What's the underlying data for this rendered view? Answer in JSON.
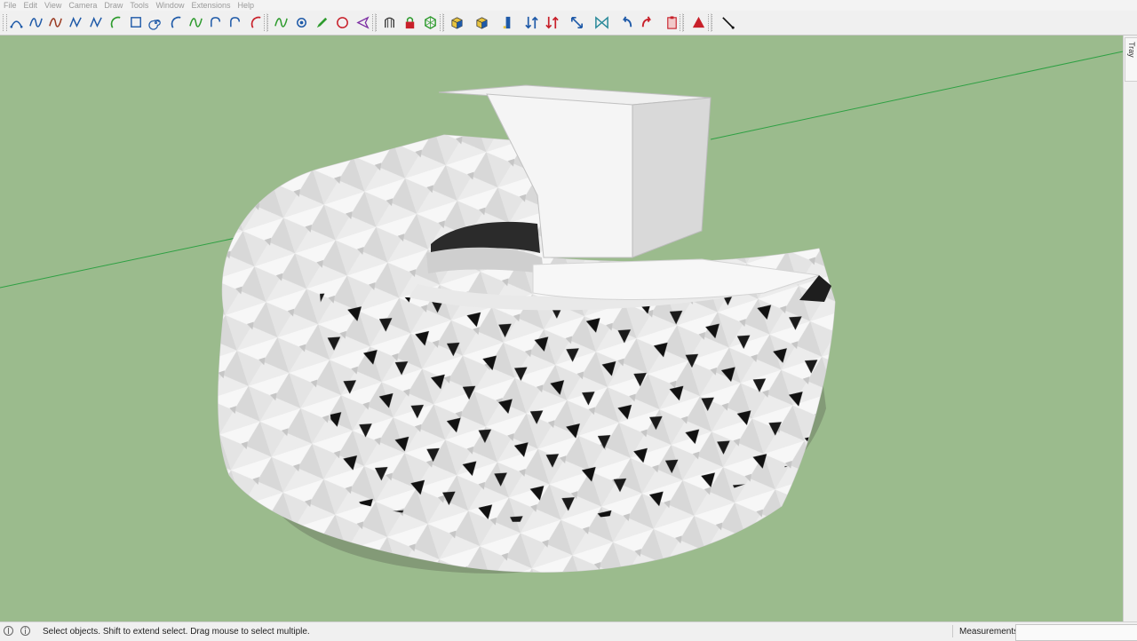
{
  "menu": [
    "File",
    "Edit",
    "View",
    "Camera",
    "Draw",
    "Tools",
    "Window",
    "Extensions",
    "Help"
  ],
  "toolbar": {
    "icons": [
      {
        "name": "bezier-curve-icon",
        "color": "#1f5aa8",
        "glyph": "arch"
      },
      {
        "name": "spline-tool-icon",
        "color": "#1f5aa8",
        "glyph": "wave"
      },
      {
        "name": "freehand-spline-icon",
        "color": "#9b3b22",
        "glyph": "wave"
      },
      {
        "name": "polyline-curve-icon",
        "color": "#1f5aa8",
        "glyph": "zigzag"
      },
      {
        "name": "curve-node-icon",
        "color": "#1f5aa8",
        "glyph": "zigzag"
      },
      {
        "name": "arc-green-icon",
        "color": "#2e9b2e",
        "glyph": "arc"
      },
      {
        "name": "rectangle-tool-icon",
        "color": "#1f5aa8",
        "glyph": "square"
      },
      {
        "name": "spiral-icon",
        "color": "#1f5aa8",
        "glyph": "spiral"
      },
      {
        "name": "arc-tool-icon",
        "color": "#1f5aa8",
        "glyph": "arc"
      },
      {
        "name": "sine-curve-icon",
        "color": "#2e9b2e",
        "glyph": "wave"
      },
      {
        "name": "catenary-curve-icon",
        "color": "#1f5aa8",
        "glyph": "hook"
      },
      {
        "name": "arch-curve-icon",
        "color": "#1f5aa8",
        "glyph": "hook"
      },
      {
        "name": "red-arc-icon",
        "color": "#c8202a",
        "glyph": "arc"
      },
      {
        "name": "line-weave-icon",
        "color": "#2e9b2e",
        "glyph": "wave"
      },
      {
        "name": "polygon-circle-icon",
        "color": "#1f5aa8",
        "glyph": "gear"
      },
      {
        "name": "pencil-tool-icon",
        "color": "#2e9b2e",
        "glyph": "pencil"
      },
      {
        "name": "circle-tool-icon",
        "color": "#c8202a",
        "glyph": "circle"
      },
      {
        "name": "wedge-tool-icon",
        "color": "#7d2fa3",
        "glyph": "wedge"
      },
      {
        "name": "shell-component-icon",
        "color": "#3a3a3a",
        "glyph": "shell"
      },
      {
        "name": "lock-component-icon",
        "color": "#c8202a",
        "glyph": "lock"
      },
      {
        "name": "hexagon-mesh-icon",
        "color": "#2e9b2e",
        "glyph": "hex"
      },
      {
        "name": "push-pull-cube-icon",
        "color": "#1f5aa8",
        "glyph": "cube"
      },
      {
        "name": "solid-cube-icon",
        "color": "#1f5aa8",
        "glyph": "cube"
      },
      {
        "name": "extrude-column-icon",
        "color": "#1f5aa8",
        "glyph": "column"
      },
      {
        "name": "move-up-down-icon",
        "color": "#1f5aa8",
        "glyph": "arrows"
      },
      {
        "name": "flip-arrows-icon",
        "color": "#c8202a",
        "glyph": "arrows"
      },
      {
        "name": "scale-diagonal-icon",
        "color": "#1f5aa8",
        "glyph": "diag"
      },
      {
        "name": "bowtie-frame-icon",
        "color": "#2a8a9a",
        "glyph": "bowtie"
      },
      {
        "name": "undo-curve-icon",
        "color": "#1f5aa8",
        "glyph": "undo"
      },
      {
        "name": "redo-curve-icon",
        "color": "#c8202a",
        "glyph": "redo"
      },
      {
        "name": "clipboard-icon",
        "color": "#c8202a",
        "glyph": "clip"
      },
      {
        "name": "red-triangle-icon",
        "color": "#c8202a",
        "glyph": "triangle"
      },
      {
        "name": "line-draw-icon",
        "color": "#111111",
        "glyph": "line"
      }
    ]
  },
  "viewport": {
    "sky_color": "#9bbb8d",
    "green_axis_color": "#2ea043"
  },
  "tray": {
    "label": "Default Tray"
  },
  "status": {
    "text": "Select objects. Shift to extend select. Drag mouse to select multiple.",
    "measurements_label": "Measurements",
    "measurements_value": ""
  }
}
